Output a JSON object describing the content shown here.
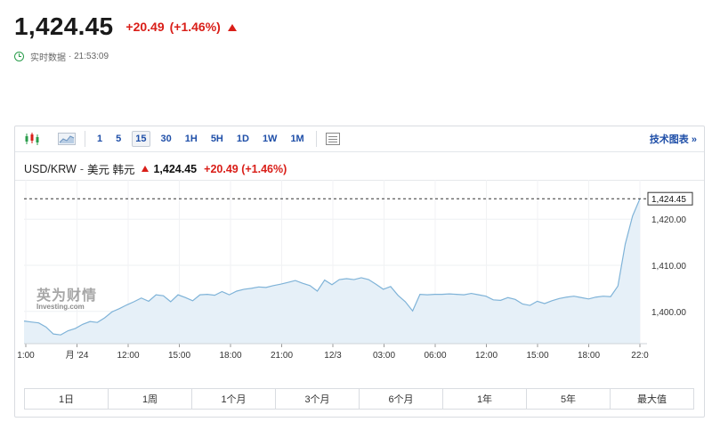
{
  "quote": {
    "price": "1,424.45",
    "change": "+20.49",
    "change_pct": "(+1.46%)",
    "status_label": "实时数据",
    "status_time": "· 21:53:09",
    "up_color": "#d91e18"
  },
  "toolbar": {
    "chart_type_icons": [
      "candlestick-icon",
      "area-chart-icon"
    ],
    "timeframes": [
      "1",
      "5",
      "15",
      "30",
      "1H",
      "5H",
      "1D",
      "1W",
      "1M"
    ],
    "active_timeframe": "15",
    "technical_link": "技术图表 »"
  },
  "pair": {
    "symbol": "USD/KRW",
    "separator": "-",
    "description": "美元 韩元",
    "price": "1,424.45",
    "change": "+20.49 (+1.46%)"
  },
  "watermark": {
    "cn": "英为财情",
    "en": "Investing.com"
  },
  "chart_data": {
    "type": "area",
    "title": "",
    "x_ticks": [
      "1:00",
      "月 '24",
      "12:00",
      "15:00",
      "18:00",
      "21:00",
      "12/3",
      "03:00",
      "06:00",
      "12:00",
      "15:00",
      "18:00",
      "22:0"
    ],
    "y_ticks": [
      "1,420.00",
      "1,410.00",
      "1,400.00"
    ],
    "ylim": [
      1393,
      1427
    ],
    "last_value_label": "1,424.45",
    "last_value": 1424.45,
    "series": [
      {
        "values": [
          1397.9,
          1397.7,
          1397.5,
          1396.6,
          1395.1,
          1394.9,
          1395.8,
          1396.3,
          1397.2,
          1397.8,
          1397.6,
          1398.6,
          1399.9,
          1400.6,
          1401.4,
          1402.1,
          1402.9,
          1402.2,
          1403.6,
          1403.4,
          1402.1,
          1403.6,
          1403.0,
          1402.3,
          1403.6,
          1403.7,
          1403.5,
          1404.3,
          1403.6,
          1404.4,
          1404.8,
          1405.0,
          1405.3,
          1405.2,
          1405.6,
          1405.9,
          1406.3,
          1406.7,
          1406.1,
          1405.6,
          1404.4,
          1406.8,
          1405.8,
          1406.9,
          1407.1,
          1406.9,
          1407.3,
          1406.9,
          1405.9,
          1404.8,
          1405.4,
          1403.5,
          1402.1,
          1400.1,
          1403.7,
          1403.6,
          1403.7,
          1403.7,
          1403.8,
          1403.7,
          1403.6,
          1403.9,
          1403.6,
          1403.3,
          1402.5,
          1402.4,
          1403.0,
          1402.6,
          1401.6,
          1401.3,
          1402.2,
          1401.7,
          1402.3,
          1402.8,
          1403.1,
          1403.3,
          1403.0,
          1402.7,
          1403.1,
          1403.3,
          1403.2,
          1405.5,
          1414.6,
          1420.7,
          1424.45
        ]
      }
    ],
    "grid": true,
    "line_color": "#7fb3d8",
    "fill_color": "#e6f0f8"
  },
  "ranges": [
    "1日",
    "1周",
    "1个月",
    "3个月",
    "6个月",
    "1年",
    "5年",
    "最大值"
  ]
}
